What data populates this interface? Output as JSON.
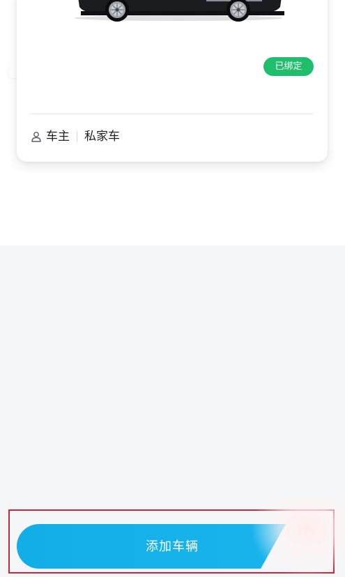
{
  "vehicle_card": {
    "status_badge": "已绑定",
    "owner_label": "车主",
    "car_type": "私家车"
  },
  "add_vehicle": {
    "label": "添加车辆"
  },
  "icons": {
    "owner": "person-icon"
  },
  "colors": {
    "badge_green": "#1ebe6c",
    "button_blue": "#12aee8",
    "page_background": "#f5f6f8",
    "highlight_red": "#c8283a"
  }
}
